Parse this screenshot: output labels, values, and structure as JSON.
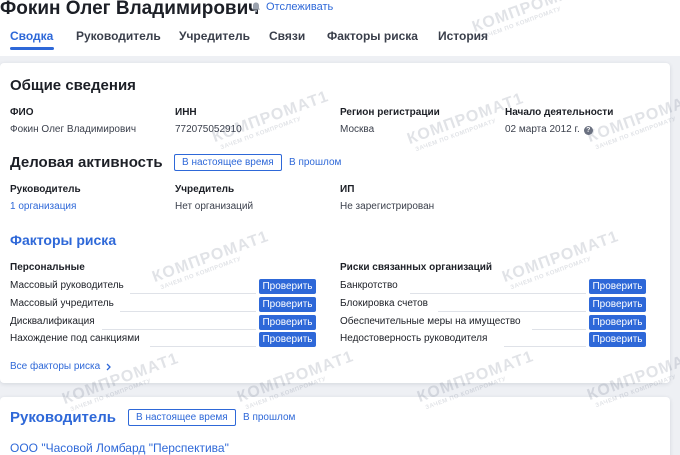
{
  "header": {
    "person_name": "Фокин Олег Владимирович",
    "track_label": "Отслеживать"
  },
  "tabs": [
    {
      "label": "Сводка",
      "active": true
    },
    {
      "label": "Руководитель",
      "active": false
    },
    {
      "label": "Учредитель",
      "active": false
    },
    {
      "label": "Связи",
      "active": false
    },
    {
      "label": "Факторы риска",
      "active": false
    },
    {
      "label": "История",
      "active": false
    }
  ],
  "general": {
    "title": "Общие сведения",
    "fields": [
      {
        "label": "ФИО",
        "value": "Фокин Олег Владимирович"
      },
      {
        "label": "ИНН",
        "value": "772075052910"
      },
      {
        "label": "Регион регистрации",
        "value": "Москва"
      },
      {
        "label": "Начало деятельности",
        "value": "02 марта 2012 г."
      }
    ]
  },
  "business": {
    "title": "Деловая активность",
    "tab_current": "В настоящее время",
    "tab_past": "В прошлом",
    "fields": [
      {
        "label": "Руководитель",
        "value": "1 организация"
      },
      {
        "label": "Учредитель",
        "value": "Нет организаций"
      },
      {
        "label": "ИП",
        "value": "Не зарегистрирован"
      }
    ]
  },
  "risks": {
    "title": "Факторы риска",
    "personal_title": "Персональные",
    "related_title": "Риски связанных организаций",
    "check_label": "Проверить",
    "personal": [
      "Массовый руководитель",
      "Массовый учредитель",
      "Дисквалификация",
      "Нахождение под санкциями"
    ],
    "related": [
      "Банкротство",
      "Блокировка счетов",
      "Обеспечительные меры на имущество",
      "Недостоверность руководителя"
    ],
    "all_link": "Все факторы риска"
  },
  "manager": {
    "title": "Руководитель",
    "tab_current": "В настоящее время",
    "tab_past": "В прошлом",
    "company": "ООО \"Часовой Ломбард \"Перспектива\""
  },
  "watermark": {
    "brand": "КОМПРОМАТ1",
    "tagline": "ЗАЧЕМ ПО КОМПРОМАТУ"
  },
  "colors": {
    "accent": "#2e68d8",
    "text": "#1c1f26",
    "background": "#eef0f4"
  }
}
